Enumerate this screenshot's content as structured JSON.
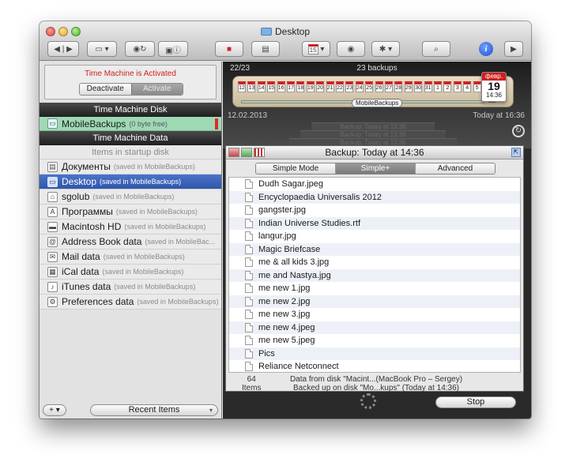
{
  "window": {
    "title": "Desktop"
  },
  "toolbar": {
    "back": "◀",
    "forward": "▶",
    "calendar_day": "15",
    "info": "i"
  },
  "sidebar": {
    "status": "Time Machine is Activated",
    "deactivate": "Deactivate",
    "activate": "Activate",
    "disk_header": "Time Machine Disk",
    "disk": {
      "name": "MobileBackups",
      "detail": "(0 byte free)"
    },
    "data_header": "Time Machine Data",
    "startup": "Items in startup disk",
    "items": [
      {
        "name": "Документы",
        "detail": "(saved in MobileBackups)",
        "icon": "document-icon"
      },
      {
        "name": "Desktop",
        "detail": "(saved in MobileBackups)",
        "icon": "desktop-icon"
      },
      {
        "name": "sgolub",
        "detail": "(saved in MobileBackups)",
        "icon": "home-icon"
      },
      {
        "name": "Программы",
        "detail": "(saved in MobileBackups)",
        "icon": "applications-icon"
      },
      {
        "name": "Macintosh HD",
        "detail": "(saved in MobileBackups)",
        "icon": "hard-drive-icon"
      },
      {
        "name": "Address Book data",
        "detail": "(saved in MobileBac...",
        "icon": "address-book-icon"
      },
      {
        "name": "Mail data",
        "detail": "(saved in MobileBackups)",
        "icon": "mail-icon"
      },
      {
        "name": "iCal data",
        "detail": "(saved in MobileBackups)",
        "icon": "calendar-icon"
      },
      {
        "name": "iTunes data",
        "detail": "(saved in MobileBackups)",
        "icon": "itunes-icon"
      },
      {
        "name": "Preferences data",
        "detail": "(saved in MobileBackups)",
        "icon": "preferences-icon"
      }
    ],
    "add": "+ ▾",
    "recent": "Recent Items"
  },
  "timeline": {
    "position": "22/23",
    "count": "23 backups",
    "disk_label": "MobileBackups",
    "start_date": "12.02.2013",
    "end_date": "Today at 16:36",
    "days": [
      "12",
      "13",
      "14",
      "15",
      "16",
      "17",
      "18",
      "19",
      "20",
      "21",
      "22",
      "23",
      "24",
      "25",
      "26",
      "27",
      "28",
      "29",
      "30",
      "31",
      "1",
      "2",
      "3",
      "4",
      "5"
    ],
    "big_month": "февр.",
    "big_day": "19",
    "big_time": "14:36",
    "ghosts": [
      "Backup: Today at 13:36",
      "Backup: Today at 13:36",
      "Backup: Today at 13:36"
    ]
  },
  "panel": {
    "title": "Backup: Today at 14:36",
    "tabs": [
      "Simple Mode",
      "Simple+",
      "Advanced"
    ],
    "files": [
      "Dudh Sagar.jpeg",
      "Encyclopaedia Universalis 2012",
      "gangster.jpg",
      "Indian Universe Studies.rtf",
      "langur.jpg",
      "Magic Briefcase",
      "me & all kids 3.jpg",
      "me and Nastya.jpg",
      "me new 1.jpg",
      "me new 2.jpg",
      "me new 3.jpg",
      "me new 4.jpeg",
      "me new 5.jpeg",
      "Pics",
      "Reliance Netconnect"
    ],
    "count": "64",
    "count_label": "Items",
    "info_line1": "Data from disk \"Macint...(MacBook Pro – Sergey)",
    "info_line2": "Backed up on disk \"Mo...kups\" (Today at 14:36)",
    "stop": "Stop"
  }
}
